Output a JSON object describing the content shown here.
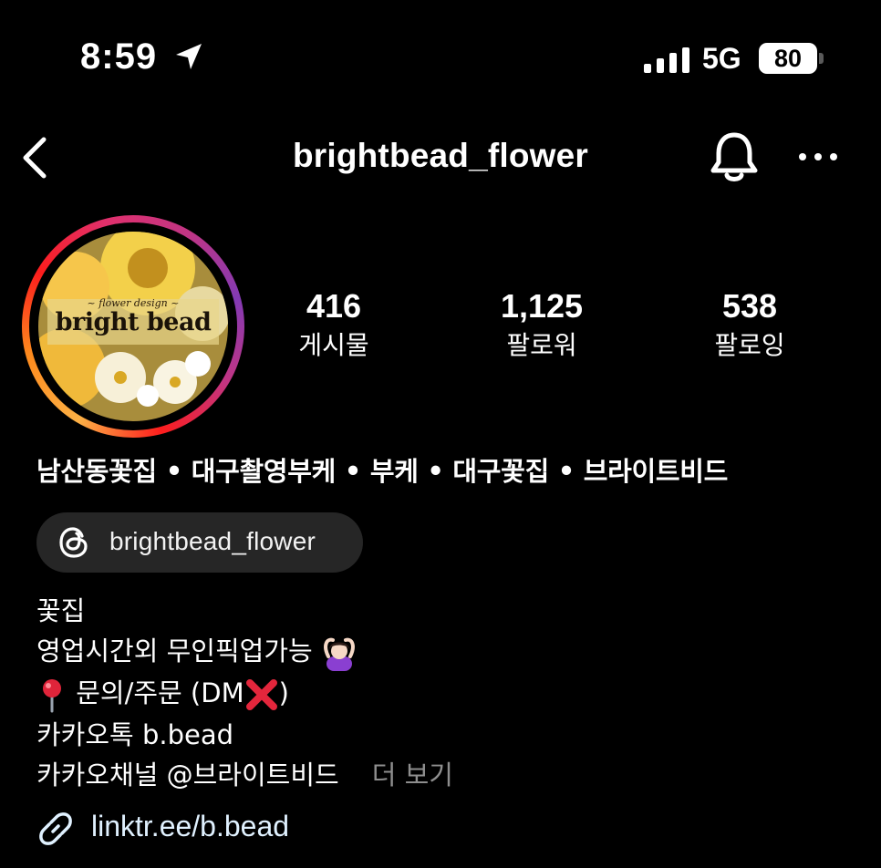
{
  "status_bar": {
    "time": "8:59",
    "network": "5G",
    "battery": "80"
  },
  "header": {
    "username": "brightbead_flower",
    "icons": [
      "back-icon",
      "bell-icon",
      "more-icon"
    ]
  },
  "avatar": {
    "logo_small": "~ flower design ~",
    "logo_main": "bright bead"
  },
  "stats": [
    {
      "value": "416",
      "label": "게시물"
    },
    {
      "value": "1,125",
      "label": "팔로워"
    },
    {
      "value": "538",
      "label": "팔로잉"
    }
  ],
  "profile": {
    "display_name": "남산동꽃집 • 대구촬영부케  • 부케 • 대구꽃집 • 브라이트비드",
    "threads_handle": "brightbead_flower",
    "bio_lines": [
      "꽃집",
      "영업시간외 무인픽업가능",
      "문의/주문 (DM",
      ")",
      "카카오톡 b.bead",
      "카카오채널 @브라이트비드"
    ],
    "more_label": "더 보기",
    "link": "linktr.ee/b.bead"
  },
  "colors": {
    "background": "#000000",
    "chip": "#262626",
    "link": "#e0f1ff",
    "muted": "#8e8e8e"
  }
}
